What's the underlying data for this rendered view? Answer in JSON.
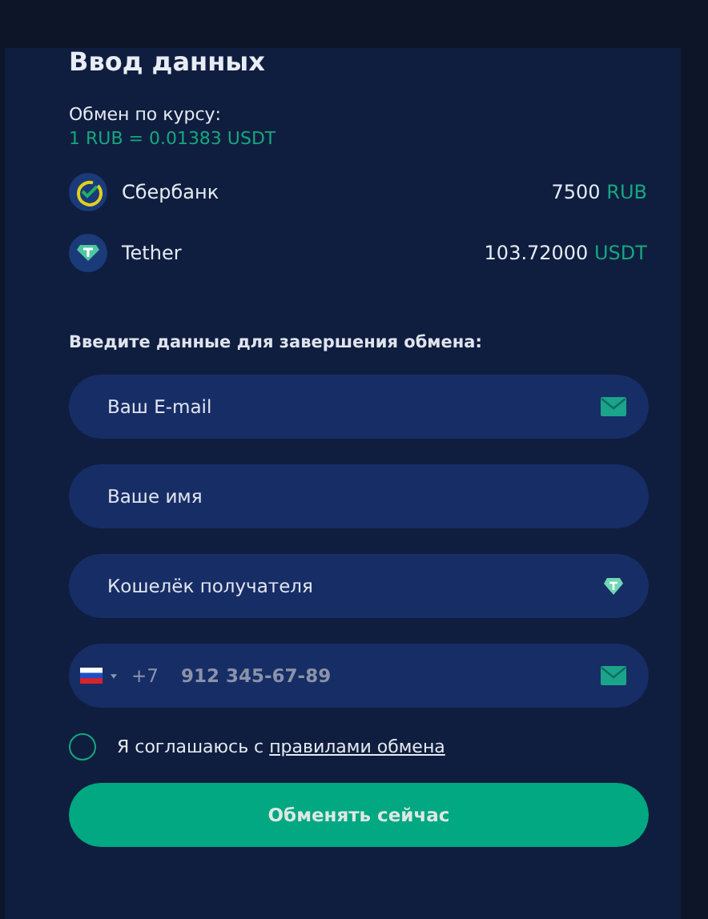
{
  "title": "Ввод данных",
  "rate": {
    "label": "Обмен по курсу:",
    "value": "1 RUB = 0.01383 USDT"
  },
  "assets": [
    {
      "kind": "sber",
      "name": "Сбербанк",
      "amount": "7500",
      "currency": "RUB"
    },
    {
      "kind": "tether",
      "name": "Tether",
      "amount": "103.72000",
      "currency": "USDT"
    }
  ],
  "form_heading": "Введите данные для завершения обмена:",
  "fields": [
    {
      "kind": "email",
      "placeholder": "Ваш E-mail"
    },
    {
      "kind": "name",
      "placeholder": "Ваше имя"
    },
    {
      "kind": "wallet",
      "placeholder": "Кошелёк получателя"
    },
    {
      "kind": "phone",
      "dial_code": "+7",
      "placeholder": "912 345-67-89"
    }
  ],
  "agreement": {
    "checked": false,
    "text": "Я соглашаюсь с",
    "link": "правилами обмена"
  },
  "submit": "Обменять сейчас"
}
